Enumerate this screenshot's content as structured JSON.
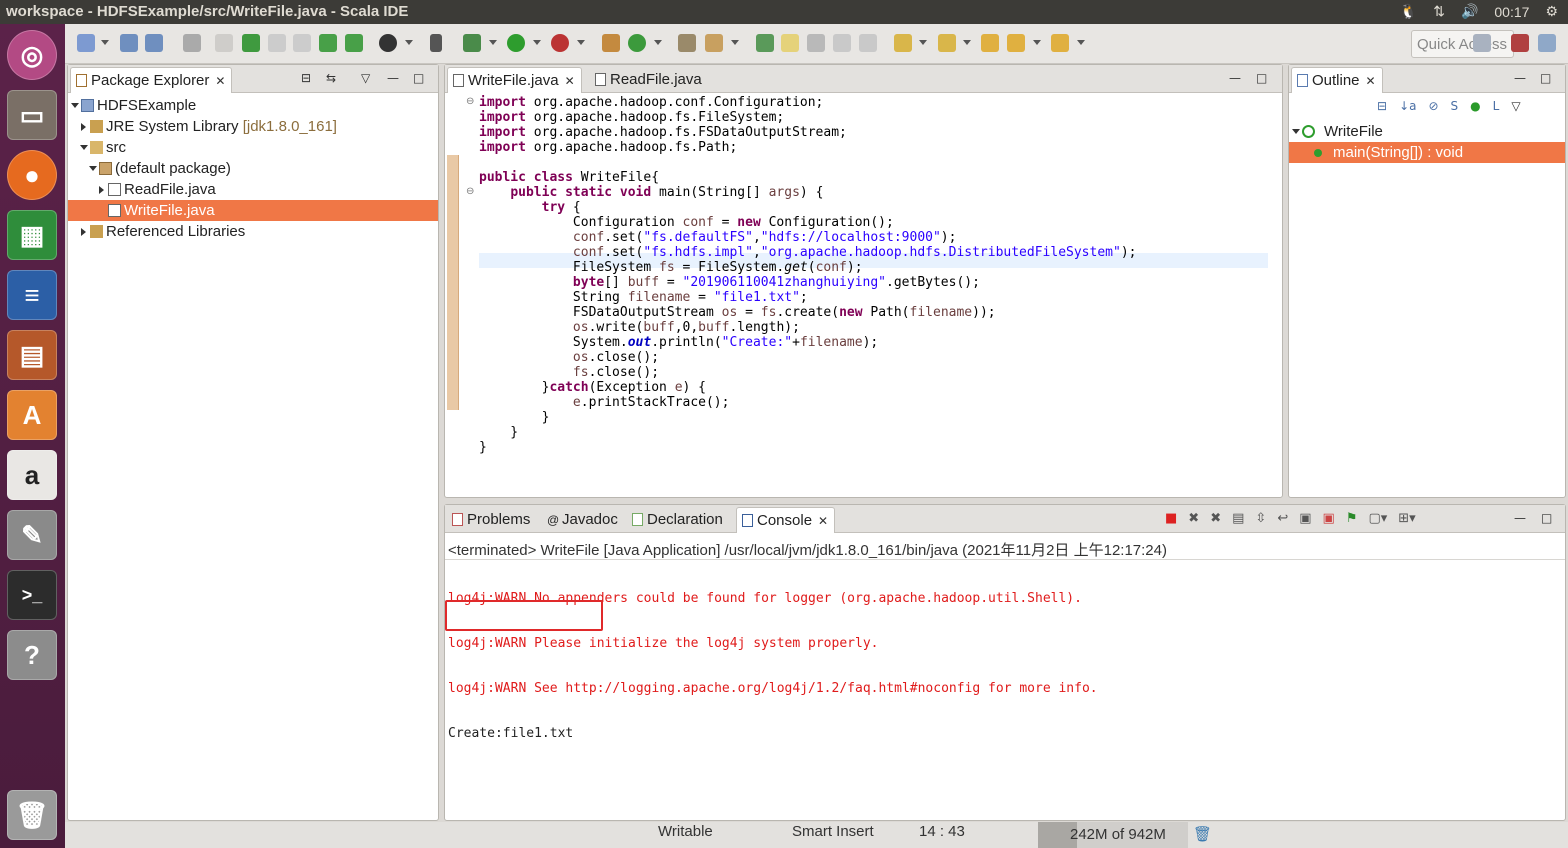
{
  "window": {
    "title": "workspace - HDFSExample/src/WriteFile.java - Scala IDE",
    "clock": "00:17"
  },
  "toolbar": {
    "quick_access_placeholder": "Quick Access"
  },
  "package_explorer": {
    "tab_label": "Package Explorer",
    "tree": [
      {
        "label": "HDFSExample",
        "depth": 0
      },
      {
        "label": "JRE System Library",
        "suffix": "[jdk1.8.0_161]",
        "depth": 1
      },
      {
        "label": "src",
        "depth": 1
      },
      {
        "label": "(default package)",
        "depth": 2
      },
      {
        "label": "ReadFile.java",
        "depth": 3
      },
      {
        "label": "WriteFile.java",
        "depth": 3,
        "selected": true
      },
      {
        "label": "Referenced Libraries",
        "depth": 1
      }
    ]
  },
  "editor": {
    "tabs": [
      {
        "label": "WriteFile.java",
        "active": true
      },
      {
        "label": "ReadFile.java",
        "active": false
      }
    ]
  },
  "outline": {
    "tab_label": "Outline",
    "items": [
      {
        "label": "WriteFile"
      },
      {
        "label": "main(String[]) : void",
        "selected": true
      }
    ]
  },
  "bottom_panel": {
    "tabs": [
      {
        "label": "Problems"
      },
      {
        "label": "Javadoc"
      },
      {
        "label": "Declaration"
      },
      {
        "label": "Console",
        "active": true
      }
    ],
    "console_header": "<terminated> WriteFile [Java Application] /usr/local/jvm/jdk1.8.0_161/bin/java (2021年11月2日 上午12:17:24)",
    "console_lines": [
      {
        "text": "log4j:WARN No appenders could be found for logger (org.apache.hadoop.util.Shell).",
        "type": "err"
      },
      {
        "text": "log4j:WARN Please initialize the log4j system properly.",
        "type": "err"
      },
      {
        "text": "log4j:WARN See http://logging.apache.org/log4j/1.2/faq.html#noconfig for more info.",
        "type": "err"
      },
      {
        "text": "Create:file1.txt",
        "type": "out"
      }
    ]
  },
  "status_bar": {
    "mode": "Writable",
    "insert": "Smart Insert",
    "position": "14 : 43",
    "heap": "242M of 942M",
    "heap_used_fraction": 0.26
  },
  "colors": {
    "selection": "#f07746",
    "launcher": "#4a1c3c",
    "keyword": "#7f0055",
    "string": "#2a00ff",
    "error_text": "#e01b1b"
  }
}
